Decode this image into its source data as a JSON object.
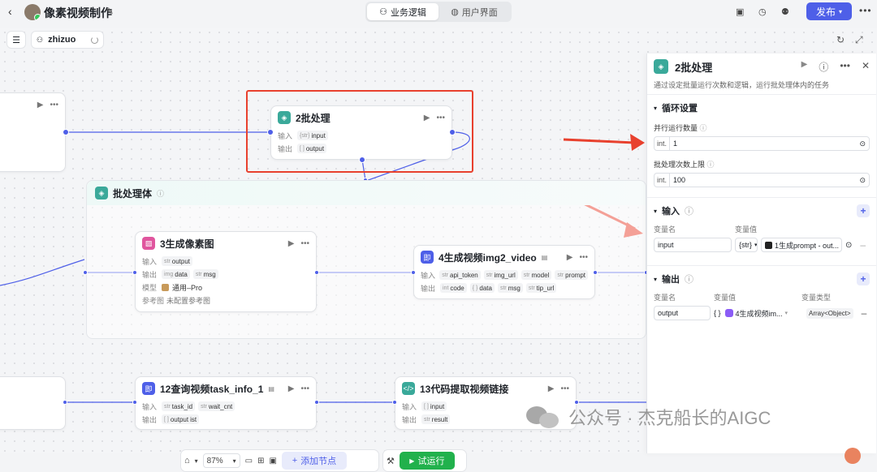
{
  "header": {
    "back": "‹",
    "title": "像素视频制作",
    "tabs": [
      {
        "label": "业务逻辑"
      },
      {
        "label": "用户界面"
      }
    ],
    "publish": "发布"
  },
  "canvas_bar": {
    "workspace": "zhizuo"
  },
  "nodes": {
    "batch": {
      "title": "2批处理",
      "in_label": "输入",
      "in_type": "{str}",
      "in_var": "input",
      "out_label": "输出",
      "out_type": "[ ]",
      "out_var": "output"
    },
    "body": {
      "title": "批处理体"
    },
    "pixel": {
      "title": "3生成像素图",
      "in_label": "输入",
      "in_var": "output",
      "in_type": "str",
      "out_label": "输出",
      "out_type1": "img",
      "out_var1": "data",
      "out_type2": "str",
      "out_var2": "msg",
      "model_label": "模型",
      "model": "通用–Pro",
      "ref_label": "参考图",
      "ref_value": "未配置参考图"
    },
    "video": {
      "title": "4生成视频img2_video",
      "in_label": "输入",
      "t": "str",
      "i1": "api_token",
      "i2": "img_url",
      "i3": "model",
      "i4": "prompt",
      "out_label": "输出",
      "int": "int",
      "o1": "code",
      "obj": "{ }",
      "o2": "data",
      "o3": "msg",
      "o4": "tip_url"
    },
    "query": {
      "title": "12查询视频task_info_1",
      "in_label": "输入",
      "t": "str",
      "i1": "task_id",
      "i2": "wait_cnt",
      "out_label": "输出",
      "arr": "[ ]",
      "o1": "output",
      "o1_suffix": "ist"
    },
    "code": {
      "title": "13代码提取视频链接",
      "in_label": "输入",
      "arr": "[ ]",
      "i1": "input",
      "out_label": "输出",
      "t": "str",
      "o1": "result"
    }
  },
  "panel": {
    "title": "2批处理",
    "desc": "通过设定批量运行次数和逻辑，运行批处理体内的任务",
    "loop": {
      "title": "循环设置",
      "parallel_label": "并行运行数量",
      "parallel_type": "int.",
      "parallel_value": "1",
      "max_label": "批处理次数上限",
      "max_type": "int.",
      "max_value": "100"
    },
    "input": {
      "title": "输入",
      "col_name": "变量名",
      "col_value": "变量值",
      "name": "input",
      "type": "{str}",
      "ref": "1生成prompt - out..."
    },
    "output": {
      "title": "输出",
      "col_name": "变量名",
      "col_value": "变量值",
      "col_type": "变量类型",
      "name": "output",
      "obj": "{ }",
      "ref": "4生成视频im...",
      "vtype": "Array<Object>"
    }
  },
  "toolbar": {
    "zoom": "87%",
    "add_node": "添加节点",
    "run": "试运行"
  },
  "watermark": {
    "text": "公众号 · 杰克船长的AIGC"
  },
  "colors": {
    "accent": "#4e5fe8",
    "run": "#21b14c",
    "highlight": "#e8412e"
  }
}
